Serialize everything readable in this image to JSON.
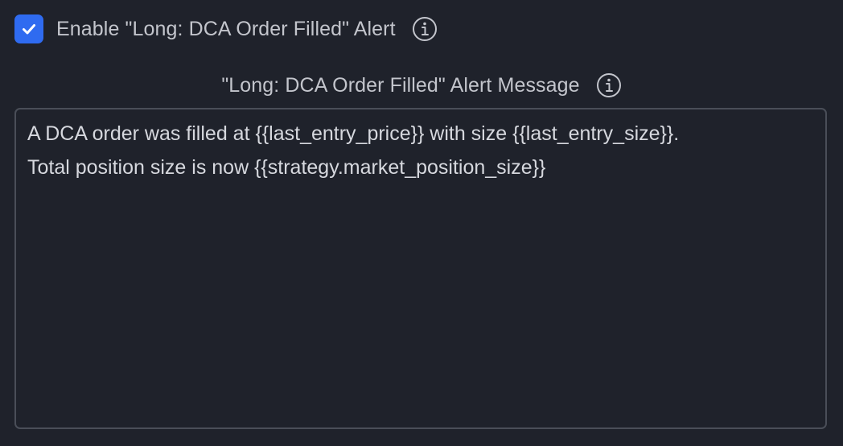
{
  "alert_toggle": {
    "checked": true,
    "label": "Enable \"Long: DCA Order Filled\" Alert",
    "info_icon": "info-circle-icon",
    "check_icon": "checkmark-icon"
  },
  "message": {
    "label": "\"Long: DCA Order Filled\" Alert Message",
    "info_icon": "info-circle-icon",
    "value": "A DCA order was filled at {{last_entry_price}} with size {{last_entry_size}}.\nTotal position size is now {{strategy.market_position_size}}"
  },
  "colors": {
    "background": "#1f222b",
    "accent": "#2f6bf0",
    "text": "#c3c5cc",
    "border": "#4a4e58"
  }
}
